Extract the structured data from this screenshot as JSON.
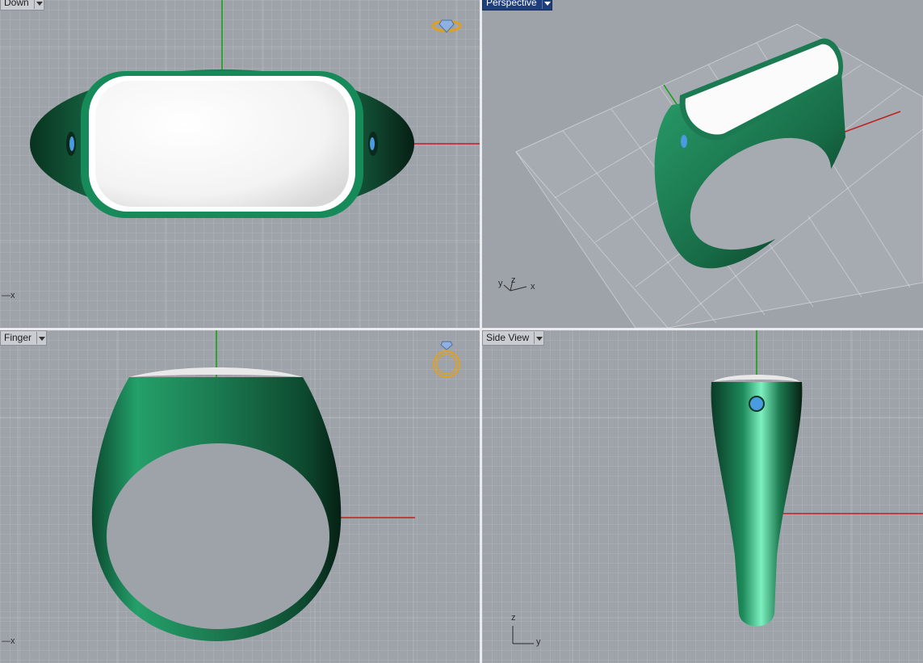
{
  "viewports": {
    "top_left": {
      "label": "Down",
      "axis_x": "x"
    },
    "top_right": {
      "label": "Perspective",
      "axis_y": "y",
      "axis_z": "z",
      "axis_x": "x"
    },
    "bottom_left": {
      "label": "Finger",
      "axis_x": "x"
    },
    "bottom_right": {
      "label": "Side View",
      "axis_z": "z",
      "axis_y": "y"
    }
  },
  "colors": {
    "background": "#9ea3a9",
    "ring_green": "#1d7a52",
    "ring_dark": "#0b3b26",
    "gem_blue": "#4a9be0",
    "axis_red": "#c02020",
    "axis_green": "#10a010",
    "widget_gold": "#e0a020",
    "active_label": "#1f3f7a"
  }
}
